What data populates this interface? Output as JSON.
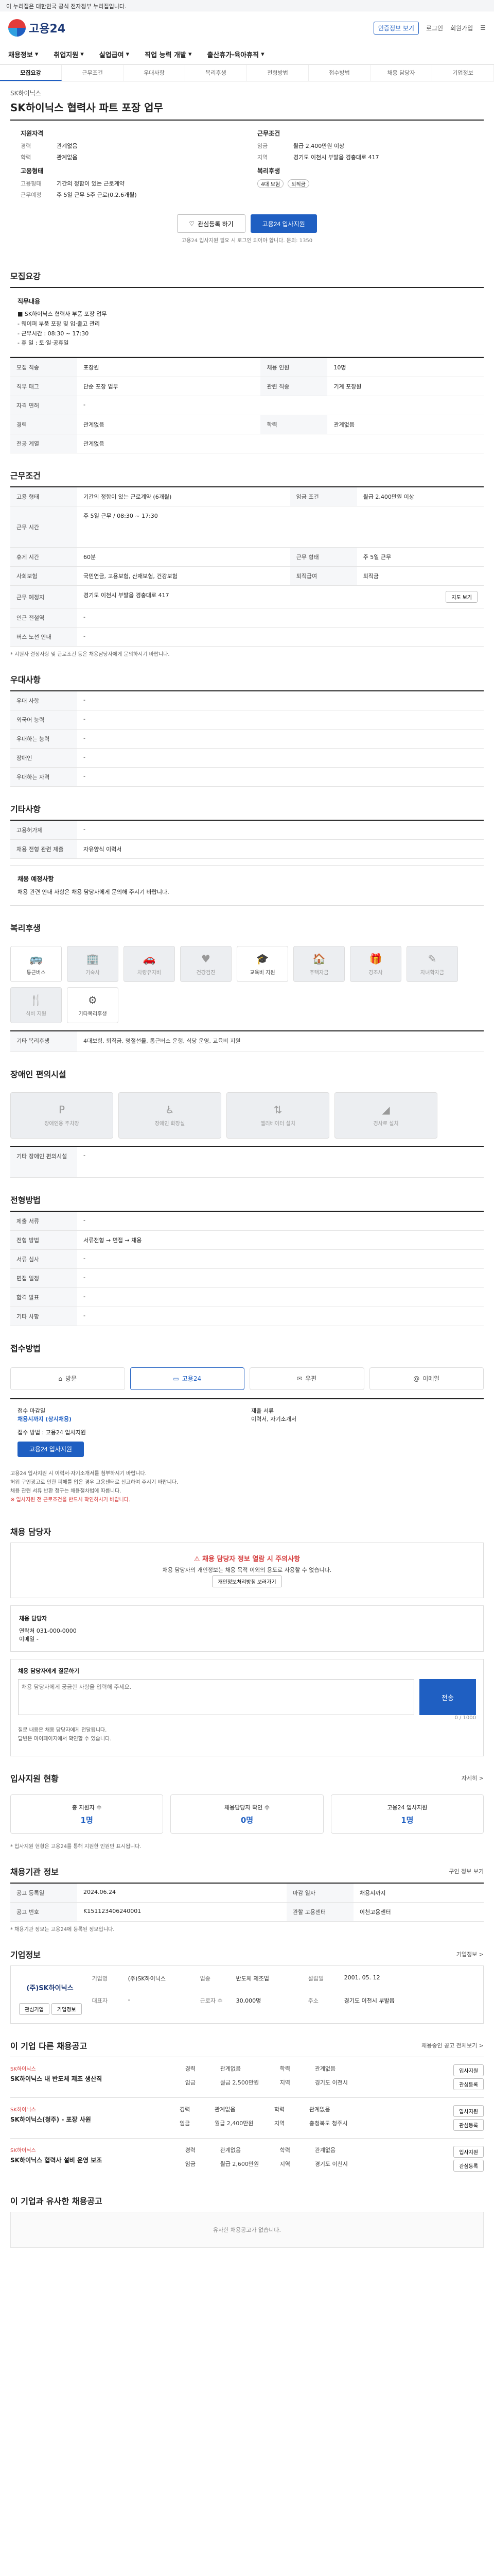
{
  "gov_bar": "이 누리집은 대한민국 공식 전자정부 누리집입니다.",
  "header": {
    "logo": "고용24",
    "auth": "인증정보 보기",
    "links": [
      "로그인",
      "회원가입"
    ]
  },
  "gnb": [
    "채용정보",
    "취업지원",
    "실업급여",
    "직업 능력 개발",
    "출산휴가·육아휴직"
  ],
  "subtabs": [
    "모집요강",
    "근무조건",
    "우대사항",
    "복리후생",
    "전형방법",
    "접수방법",
    "채용 담당자",
    "기업정보"
  ],
  "posting": {
    "company": "SK하이닉스",
    "title": "SK하이닉스 협력사 파트 포장 업무",
    "summary_left_title": "지원자격",
    "summary_left": [
      [
        "경력",
        "관계없음"
      ],
      [
        "학력",
        "관계없음"
      ]
    ],
    "summary_left2_title": "고용형태",
    "summary_left2": [
      [
        "고용형태",
        "기간의 정함이 있는 근로계약"
      ],
      [
        "근무예정",
        "주 5일 근무 5주 근로(0.2.6개월)"
      ]
    ],
    "summary_right_title": "근무조건",
    "summary_right": [
      [
        "임금",
        "월급 2,400만원 이상"
      ],
      [
        "지역",
        "경기도 이천시 부발읍 경충대로 417"
      ]
    ],
    "summary_right2_title": "복리후생",
    "chips": [
      "4대 보험",
      "퇴직금"
    ],
    "btn_interest": "관심등록 하기",
    "btn_apply": "고용24 입사지원",
    "cta_note": "고용24 입사지원 필요 시 로그인 되어야 합니다. 문의: 1350"
  },
  "sections": {
    "recruit": "모집요강",
    "work": "근무조건",
    "preference": "우대사항",
    "etc": "기타사항",
    "welfare": "복리후생",
    "disability": "장애인 편의시설",
    "selection": "전형방법",
    "apply": "접수방법",
    "contact": "채용 담당자",
    "stats": "입사지원 현황",
    "info": "채용기관 정보",
    "company": "기업정보",
    "other": "이 기업 다른 채용공고",
    "similar": "이 기업과 유사한 채용공고"
  },
  "recruit": {
    "duty_title": "직무내용",
    "duty_lines": [
      "■ SK하이닉스 협력사 부품 포장 업무",
      "- 웨이퍼 부품 포장 및 입·출고 관리",
      "- 근무시간 : 08:30 ~ 17:30",
      "- 휴 일 : 토·일·공휴일"
    ],
    "rows": [
      [
        "모집 직종",
        "포장원",
        "채용 인원",
        "10명"
      ],
      [
        "직무 태그",
        "단순 포장 업무",
        "관련 직종",
        "기계 포장원"
      ],
      [
        "자격 면허",
        "-",
        "-",
        "-"
      ],
      [
        "경력",
        "관계없음",
        "학력",
        "관계없음"
      ],
      [
        "전공 계열",
        "관계없음",
        "",
        ""
      ]
    ]
  },
  "work": {
    "rows": [
      [
        "고용 형태",
        "기간의 정함이 있는 근로계약 (6개월)",
        "임금 조건",
        "월급 2,400만원 이상"
      ],
      [
        "근무 시간",
        "주 5일 근무 / 08:30 ~ 17:30",
        "",
        ""
      ],
      [
        "휴게 시간",
        "60분",
        "근무 형태",
        "주 5일 근무"
      ],
      [
        "사회보험",
        "국민연금, 고용보험, 산재보험, 건강보험",
        "퇴직급여",
        "퇴직금"
      ],
      [
        "근무 예정지",
        "경기도 이천시 부발읍 경충대로 417",
        "",
        ""
      ],
      [
        "인근 전철역",
        "-",
        "",
        ""
      ],
      [
        "버스 노선 안내",
        "-",
        "",
        ""
      ]
    ],
    "map_btn": "지도 보기",
    "note": "* 지원자 결정사항 및 근로조건 등은 채용담당자에게 문의하시기 바랍니다."
  },
  "preference": [
    [
      "우대 사항",
      "-"
    ],
    [
      "외국어 능력",
      "-"
    ],
    [
      "우대하는 능력",
      "-"
    ],
    [
      "장애인",
      "-"
    ],
    [
      "우대하는 자격",
      "-"
    ]
  ],
  "etc": [
    [
      "고용허가제",
      "-"
    ],
    [
      "채용 전형 관련 제출",
      "자유양식 이력서"
    ]
  ],
  "etc_notice_title": "채용 예정사항",
  "etc_notice": "채용 관련 안내 사항은 채용 담당자에게 문의해 주시기 바랍니다.",
  "welfare": {
    "tiles": [
      {
        "label": "통근버스",
        "glyph": "🚌",
        "on": true
      },
      {
        "label": "기숙사",
        "glyph": "🏢",
        "on": false
      },
      {
        "label": "차량유지비",
        "glyph": "🚗",
        "on": false
      },
      {
        "label": "건강검진",
        "glyph": "♥",
        "on": false
      },
      {
        "label": "교육비 지원",
        "glyph": "🎓",
        "on": true
      },
      {
        "label": "주택자금",
        "glyph": "🏠",
        "on": false
      },
      {
        "label": "경조사",
        "glyph": "🎁",
        "on": false
      },
      {
        "label": "자녀학자금",
        "glyph": "✎",
        "on": false
      },
      {
        "label": "식비 지원",
        "glyph": "🍴",
        "on": false
      },
      {
        "label": "기타복리후생",
        "glyph": "⚙",
        "on": true
      }
    ],
    "list_title": "기타 복리후생",
    "list": "4대보험, 퇴직금, 명절선물, 통근버스 운행, 식당 운영, 교육비 지원"
  },
  "disability": {
    "tiles": [
      "장애인용 주차장",
      "장애인 화장실",
      "엘리베이터 설치",
      "경사로 설치"
    ],
    "row": [
      "기타 장애인 편의시설",
      "-"
    ]
  },
  "selection": {
    "rows": [
      [
        "제출 서류",
        "-"
      ],
      [
        "전형 방법",
        "서류전형 → 면접 → 채용"
      ],
      [
        "서류 심사",
        "-"
      ],
      [
        "면접 일정",
        "-"
      ],
      [
        "합격 발표",
        "-"
      ],
      [
        "기타 사항",
        "-"
      ]
    ]
  },
  "apply": {
    "methods": [
      "방문",
      "고용24",
      "우편",
      "이메일"
    ],
    "deadline_label": "접수 마감일",
    "deadline": "채용시까지 (상시채용)",
    "place_label": "접수 방법",
    "place": "고용24 입사지원",
    "apply_btn": "고용24 입사지원",
    "form_label": "제출 서류",
    "form": "이력서, 자기소개서",
    "bullets": [
      "고용24 입사지원 시 이력서·자기소개서를 첨부하시기 바랍니다.",
      "허위 구인광고로 인한 피해를 입은 경우 고용센터로 신고하여 주시기 바랍니다.",
      "채용 관련 서류 반환 청구는 채용절차법에 따릅니다."
    ],
    "red_note": "※ 입사지원 전 근로조건을 반드시 확인하시기 바랍니다."
  },
  "contact": {
    "warn_title": "채용 담당자 정보 열람 시 주의사항",
    "warn_text": "채용 담당자의 개인정보는 채용 목적 이외의 용도로 사용할 수 없습니다.",
    "warn_btn": "개인정보처리방침 보러가기",
    "dept": "채용 담당자",
    "phone_label": "연락처",
    "phone": "031-000-0000",
    "email_label": "이메일",
    "email": "-",
    "inquiry_title": "채용 담당자에게 질문하기",
    "inquiry_placeholder": "채용 담당자에게 궁금한 사항을 입력해 주세요.",
    "inquiry_count": "0 / 1000",
    "send": "전송",
    "notes": [
      "질문 내용은 채용 담당자에게 전달됩니다.",
      "답변은 마이페이지에서 확인할 수 있습니다."
    ]
  },
  "stats": {
    "more": "자세히 >",
    "items": [
      [
        "총 지원자 수",
        "1명"
      ],
      [
        "채용담당자 확인 수",
        "0명"
      ],
      [
        "고용24 입사지원",
        "1명"
      ]
    ],
    "note": "* 입사지원 현황은 고용24를 통해 지원한 인원만 표시됩니다."
  },
  "info": {
    "more": "구인 정보 보기",
    "rows": [
      [
        "공고 등록일",
        "2024.06.24",
        "마감 일자",
        "채용시까지"
      ],
      [
        "공고 번호",
        "K151123406240001",
        "관할 고용센터",
        "이천고용센터"
      ]
    ],
    "note": "* 채용기관 정보는 고용24에 등록된 정보입니다."
  },
  "company": {
    "more": "기업정보 >",
    "logo": "(주)SK하이닉스",
    "btns": [
      "관심기업",
      "기업정보"
    ],
    "kv": [
      [
        "기업명",
        "(주)SK하이닉스"
      ],
      [
        "업종",
        "반도체 제조업"
      ],
      [
        "설립일",
        "2001. 05. 12"
      ],
      [
        "대표자",
        "-"
      ],
      [
        "근로자 수",
        "30,000명"
      ],
      [
        "주소",
        "경기도 이천시 부발읍"
      ]
    ]
  },
  "other_more": "채용중인 공고 전체보기 >",
  "other_jobs": [
    {
      "company": "SK하이닉스",
      "title": "SK하이닉스 내 반도체 제조 생산직",
      "meta": [
        [
          "경력",
          "관계없음"
        ],
        [
          "학력",
          "관계없음"
        ],
        [
          "임금",
          "월급 2,500만원"
        ],
        [
          "지역",
          "경기도 이천시"
        ]
      ],
      "actions": [
        "입사지원",
        "관심등록"
      ]
    },
    {
      "company": "SK하이닉스",
      "title": "SK하이닉스(청주) - 포장 사원",
      "meta": [
        [
          "경력",
          "관계없음"
        ],
        [
          "학력",
          "관계없음"
        ],
        [
          "임금",
          "월급 2,400만원"
        ],
        [
          "지역",
          "충청북도 청주시"
        ]
      ],
      "actions": [
        "입사지원",
        "관심등록"
      ]
    },
    {
      "company": "SK하이닉스",
      "title": "SK하이닉스 협력사 설비 운영 보조",
      "meta": [
        [
          "경력",
          "관계없음"
        ],
        [
          "학력",
          "관계없음"
        ],
        [
          "임금",
          "월급 2,600만원"
        ],
        [
          "지역",
          "경기도 이천시"
        ]
      ],
      "actions": [
        "입사지원",
        "관심등록"
      ]
    }
  ],
  "similar_empty": "유사한 채용공고가 없습니다."
}
